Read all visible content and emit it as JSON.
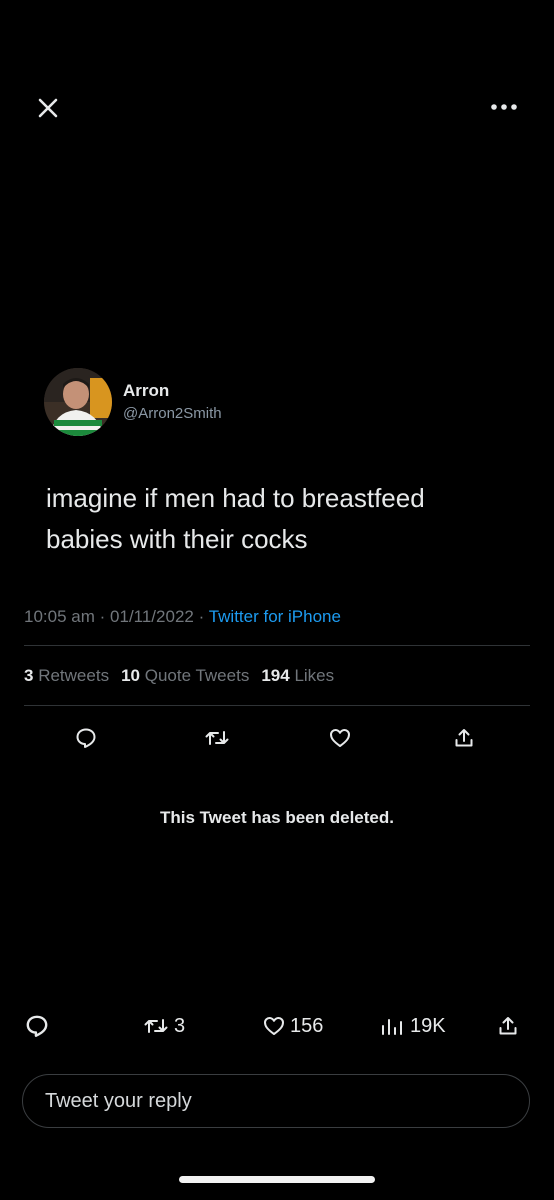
{
  "header": {
    "close_icon": "close-icon",
    "more_icon": "more-horizontal-icon"
  },
  "author": {
    "display_name": "Arron",
    "handle": "@Arron2Smith"
  },
  "tweet": {
    "text_line1": "imagine if men had to breastfeed",
    "text_line2": "babies with their cocks",
    "time": "10:05 am",
    "date": "01/11/2022",
    "source": "Twitter for iPhone",
    "separator": "·"
  },
  "stats": {
    "retweets_count": "3",
    "retweets_label": "Retweets",
    "quotes_count": "10",
    "quotes_label": "Quote Tweets",
    "likes_count": "194",
    "likes_label": "Likes"
  },
  "actions": {
    "icons": [
      "reply-icon",
      "retweet-icon",
      "like-icon",
      "share-icon"
    ]
  },
  "deleted_notice": "This Tweet has been deleted.",
  "bottom_bar": {
    "retweets": "3",
    "likes": "156",
    "views": "19K"
  },
  "reply": {
    "placeholder": "Tweet your reply"
  },
  "colors": {
    "background": "#000000",
    "text": "#e7e9ea",
    "secondary": "#71767b",
    "link": "#1d9bf0"
  }
}
